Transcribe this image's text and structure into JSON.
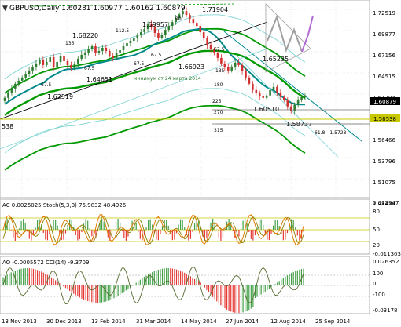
{
  "header": {
    "symbol_icon": "triangle-down-icon",
    "title_text": "GBPUSD,Daily  1.60281 1.60977 1.60162 1.60879"
  },
  "colors": {
    "background": "#ffffff",
    "grid": "#c8d6d6",
    "bull_candle": "#2e7d32",
    "bear_candle": "#d32f2f",
    "ma_dark_green": "#009900",
    "ma_teal": "#008b8b",
    "channel_line": "#000000",
    "bands": "#7fd4d4",
    "fib_line": "#9a9a9a",
    "current_price_bg": "#000000",
    "level_price_bg": "#c8c800",
    "forecast_grey": "#a0a0a0",
    "forecast_violet": "#b36bd4",
    "osc_red": "#e53935",
    "osc_green": "#43a047",
    "stoch_orange": "#e07b00",
    "stoch_signal": "#8b7d00",
    "cci_olive": "#556b2f"
  },
  "main_chart": {
    "price_axis_labels": [
      "1.72519",
      "1.69877",
      "1.67156",
      "1.64515",
      "1.61794",
      "1.59158",
      "1.56466",
      "1.53796",
      "1.51075",
      "1.48434"
    ],
    "current_price_label": "1.60879",
    "level_price_label": "1.58538",
    "left_level_label": "538",
    "price_annotations": [
      {
        "text": "1.71904"
      },
      {
        "text": "1.69957"
      },
      {
        "text": "1.68220"
      },
      {
        "text": "1.66923"
      },
      {
        "text": "1.65235"
      },
      {
        "text": "1.64651"
      },
      {
        "text": "1.62519"
      },
      {
        "text": "1.60510"
      },
      {
        "text": "1.58737"
      },
      {
        "text": "61.8 - 1.5728"
      }
    ],
    "fib_labels": [
      {
        "text": "90"
      },
      {
        "text": "112.5"
      },
      {
        "text": "135"
      },
      {
        "text": "67.5"
      },
      {
        "text": "67.5"
      },
      {
        "text": "67.5"
      },
      {
        "text": "67.5"
      },
      {
        "text": "67.5"
      },
      {
        "text": "135"
      },
      {
        "text": "180"
      },
      {
        "text": "225"
      },
      {
        "text": "270"
      },
      {
        "text": "315"
      }
    ],
    "comment_text": "минимум от 24 марта 2014"
  },
  "stoch_panel": {
    "title": "AC 0.0025025  Stoch(5,3,3) 75.9832 48.4926",
    "axis_labels": [
      "0.012947",
      "80",
      "50",
      "20",
      "-0.011303"
    ]
  },
  "cci_panel": {
    "title": "AO -0.0005572  CCI(14) -9.3709",
    "axis_labels": [
      "0.026352",
      "100",
      "0",
      "-100",
      "-0.03178"
    ]
  },
  "time_axis": {
    "labels": [
      "13 Nov 2013",
      "30 Dec 2013",
      "13 Feb 2014",
      "31 Mar 2014",
      "14 May 2014",
      "27 Jun 2014",
      "12 Aug 2014",
      "25 Sep 2014"
    ]
  },
  "chart_data": {
    "type": "candlestick",
    "symbol": "GBPUSD",
    "timeframe": "Daily",
    "ohlc_last": {
      "open": 1.60281,
      "high": 1.60977,
      "low": 1.60162,
      "close": 1.60879
    },
    "y_range": [
      1.4843,
      1.7252
    ],
    "x_labels": [
      "13 Nov 2013",
      "30 Dec 2013",
      "13 Feb 2014",
      "31 Mar 2014",
      "14 May 2014",
      "27 Jun 2014",
      "12 Aug 2014",
      "25 Sep 2014"
    ],
    "close_series": [
      1.606,
      1.612,
      1.618,
      1.624,
      1.628,
      1.632,
      1.636,
      1.641,
      1.645,
      1.65,
      1.655,
      1.648,
      1.652,
      1.658,
      1.645,
      1.652,
      1.66,
      1.653,
      1.648,
      1.644,
      1.65,
      1.656,
      1.661,
      1.664,
      1.668,
      1.672,
      1.664,
      1.666,
      1.67,
      1.666,
      1.66,
      1.657,
      1.663,
      1.667,
      1.672,
      1.676,
      1.679,
      1.682,
      1.686,
      1.69,
      1.694,
      1.7,
      1.696,
      1.689,
      1.683,
      1.687,
      1.693,
      1.698,
      1.703,
      1.708,
      1.713,
      1.717,
      1.712,
      1.707,
      1.702,
      1.698,
      1.69,
      1.682,
      1.674,
      1.668,
      1.663,
      1.657,
      1.65,
      1.645,
      1.641,
      1.646,
      1.651,
      1.648,
      1.64,
      1.632,
      1.624,
      1.616,
      1.612,
      1.608,
      1.606,
      1.609,
      1.616,
      1.62,
      1.613,
      1.607,
      1.603,
      1.595,
      1.589,
      1.597,
      1.603,
      1.607,
      1.609
    ],
    "moving_averages": [
      "dark green",
      "teal"
    ],
    "key_levels": [
      1.71904,
      1.69957,
      1.6822,
      1.66923,
      1.65235,
      1.64651,
      1.62519,
      1.6051,
      1.58737,
      1.58538,
      1.5728
    ],
    "indicators": [
      {
        "name": "AC",
        "value": 0.0025025
      },
      {
        "name": "Stoch(5,3,3)",
        "main": 75.9832,
        "signal": 48.4926,
        "levels": [
          20,
          50,
          80
        ]
      },
      {
        "name": "AO",
        "value": -0.0005572
      },
      {
        "name": "CCI(14)",
        "value": -9.3709,
        "levels": [
          -100,
          0,
          100
        ]
      }
    ]
  }
}
